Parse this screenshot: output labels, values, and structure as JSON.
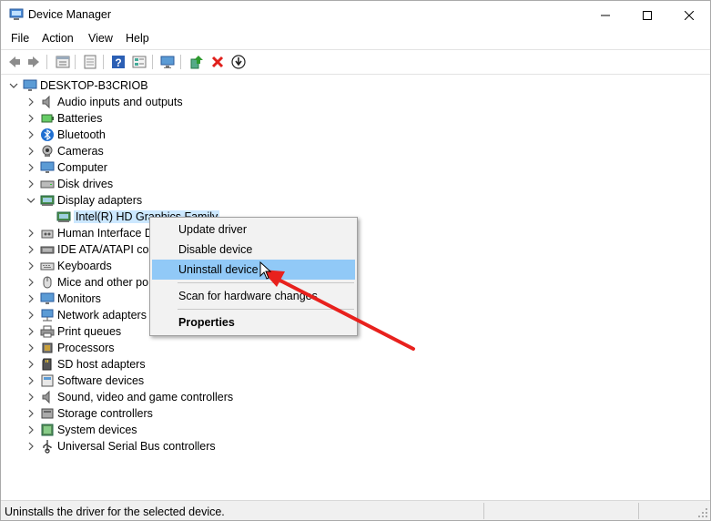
{
  "window": {
    "title": "Device Manager",
    "icon": "device-manager-icon"
  },
  "menu": {
    "file": "File",
    "action": "Action",
    "view": "View",
    "help": "Help"
  },
  "toolbar": [
    "back-icon",
    "forward-icon",
    "properties-icon",
    "console-tree-icon",
    "help-icon",
    "view-icon",
    "computer-scan-icon",
    "update-driver-icon",
    "uninstall-icon",
    "download-icon"
  ],
  "tree": {
    "root": "DESKTOP-B3CRIOB",
    "items": [
      {
        "label": "Audio inputs and outputs",
        "icon": "speaker-icon",
        "expanded": false
      },
      {
        "label": "Batteries",
        "icon": "battery-icon",
        "expanded": false
      },
      {
        "label": "Bluetooth",
        "icon": "bluetooth-icon",
        "expanded": false
      },
      {
        "label": "Cameras",
        "icon": "camera-icon",
        "expanded": false
      },
      {
        "label": "Computer",
        "icon": "computer-icon",
        "expanded": false
      },
      {
        "label": "Disk drives",
        "icon": "disk-icon",
        "expanded": false
      },
      {
        "label": "Display adapters",
        "icon": "display-adapter-icon",
        "expanded": true,
        "children": [
          {
            "label": "Intel(R) HD Graphics Family",
            "icon": "display-adapter-icon",
            "selected": true
          }
        ]
      },
      {
        "label": "Human Interface D",
        "icon": "hid-icon",
        "expanded": false
      },
      {
        "label": "IDE ATA/ATAPI cor",
        "icon": "ide-icon",
        "expanded": false
      },
      {
        "label": "Keyboards",
        "icon": "keyboard-icon",
        "expanded": false
      },
      {
        "label": "Mice and other po",
        "icon": "mouse-icon",
        "expanded": false
      },
      {
        "label": "Monitors",
        "icon": "monitor-icon",
        "expanded": false
      },
      {
        "label": "Network adapters",
        "icon": "network-icon",
        "expanded": false
      },
      {
        "label": "Print queues",
        "icon": "printer-icon",
        "expanded": false
      },
      {
        "label": "Processors",
        "icon": "processor-icon",
        "expanded": false
      },
      {
        "label": "SD host adapters",
        "icon": "sd-card-icon",
        "expanded": false
      },
      {
        "label": "Software devices",
        "icon": "software-device-icon",
        "expanded": false
      },
      {
        "label": "Sound, video and game controllers",
        "icon": "speaker-icon",
        "expanded": false
      },
      {
        "label": "Storage controllers",
        "icon": "storage-icon",
        "expanded": false
      },
      {
        "label": "System devices",
        "icon": "system-device-icon",
        "expanded": false
      },
      {
        "label": "Universal Serial Bus controllers",
        "icon": "usb-icon",
        "expanded": false
      }
    ]
  },
  "context_menu": {
    "update_driver": "Update driver",
    "disable_device": "Disable device",
    "uninstall_device": "Uninstall device",
    "scan": "Scan for hardware changes",
    "properties": "Properties",
    "highlighted": "Uninstall device"
  },
  "status": {
    "text": "Uninstalls the driver for the selected device."
  },
  "colors": {
    "selection": "#cce8ff",
    "menu_highlight": "#91c9f7",
    "arrow": "#e8211d"
  }
}
